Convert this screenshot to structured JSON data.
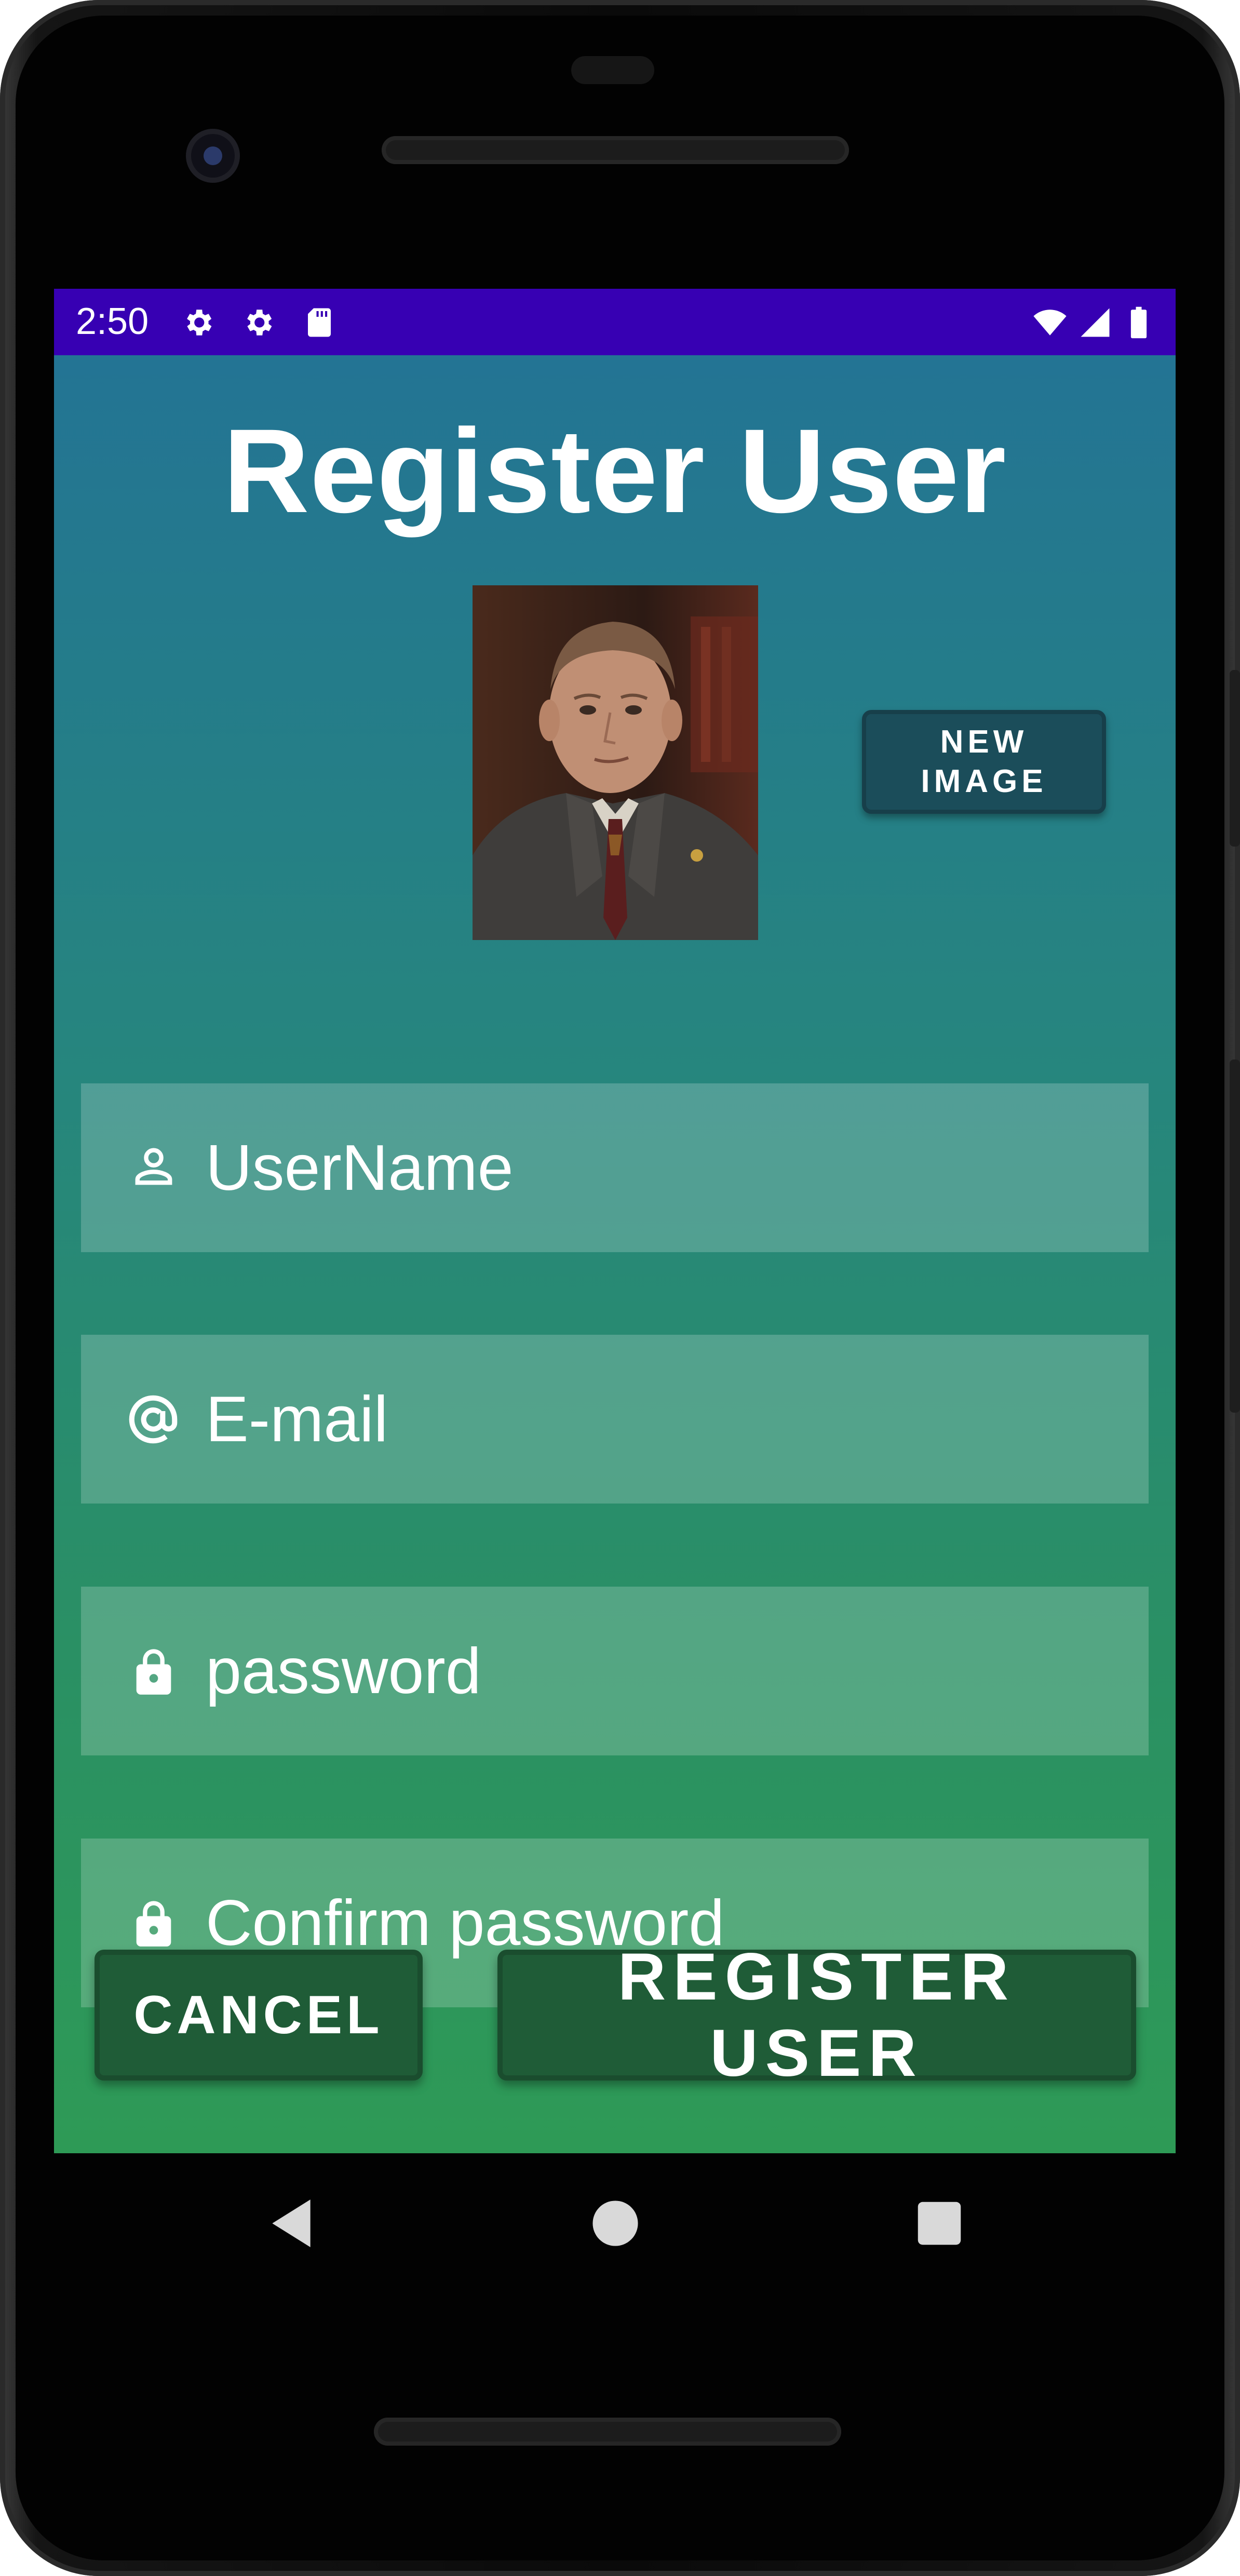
{
  "status_bar": {
    "time": "2:50",
    "background_color": "#3700b3",
    "left_icons": [
      "settings-gear-icon",
      "settings-gear-icon",
      "sd-card-icon"
    ],
    "right_icons": [
      "wifi-icon",
      "cellular-signal-icon",
      "battery-icon"
    ]
  },
  "header": {
    "title": "Register User"
  },
  "profile": {
    "image_description": "photo-of-man-in-suit",
    "new_image_label": "NEW\nIMAGE"
  },
  "form": {
    "fields": [
      {
        "name": "username",
        "placeholder": "UserName",
        "icon": "person-icon",
        "value": ""
      },
      {
        "name": "email",
        "placeholder": "E-mail",
        "icon": "at-sign-icon",
        "value": ""
      },
      {
        "name": "password",
        "placeholder": "password",
        "icon": "lock-icon",
        "value": ""
      },
      {
        "name": "confirm_password",
        "placeholder": "Confirm password",
        "icon": "lock-icon",
        "value": ""
      }
    ]
  },
  "actions": {
    "cancel_label": "CANCEL",
    "register_label": "REGISTER USER"
  },
  "nav_bar": {
    "icons": [
      "back-triangle-icon",
      "home-circle-icon",
      "recents-square-icon"
    ]
  },
  "colors": {
    "gradient_top": "#237494",
    "gradient_bottom": "#2e9a56",
    "button_fill": "#1f5c37",
    "new_image_button_fill": "#1b4d5a"
  }
}
